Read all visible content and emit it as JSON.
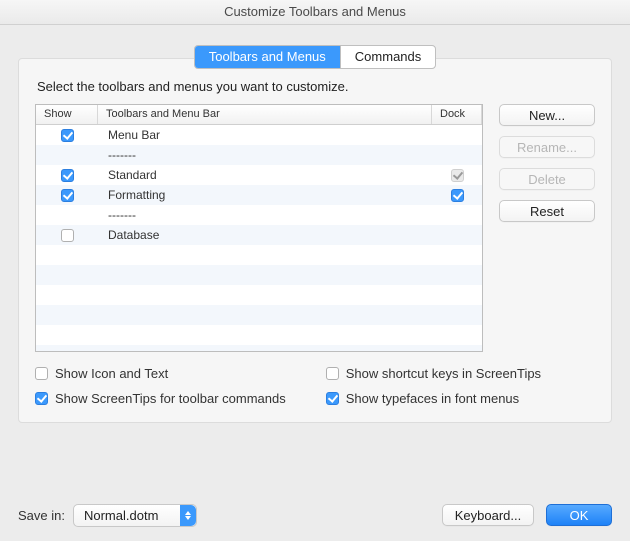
{
  "window": {
    "title": "Customize Toolbars and Menus"
  },
  "tabs": {
    "toolbars": "Toolbars and Menus",
    "commands": "Commands",
    "active": "toolbars"
  },
  "prompt": "Select the toolbars and menus you want to customize.",
  "columns": {
    "show": "Show",
    "name": "Toolbars and Menu Bar",
    "dock": "Dock"
  },
  "rows": [
    {
      "show": "on",
      "name": "Menu Bar",
      "dock": ""
    },
    {
      "show": "",
      "name": "-------",
      "dock": ""
    },
    {
      "show": "on",
      "name": "Standard",
      "dock": "dim"
    },
    {
      "show": "on",
      "name": "Formatting",
      "dock": "on"
    },
    {
      "show": "",
      "name": "-------",
      "dock": ""
    },
    {
      "show": "off",
      "name": "Database",
      "dock": ""
    }
  ],
  "side": {
    "new": "New...",
    "rename": "Rename...",
    "delete": "Delete",
    "reset": "Reset"
  },
  "options": {
    "icon_text": {
      "label": "Show Icon and Text",
      "state": "off"
    },
    "screentips": {
      "label": "Show ScreenTips for toolbar commands",
      "state": "on"
    },
    "shortcut": {
      "label": "Show shortcut keys in ScreenTips",
      "state": "off"
    },
    "typefaces": {
      "label": "Show typefaces in font menus",
      "state": "on"
    }
  },
  "footer": {
    "save_in_label": "Save in:",
    "save_in_value": "Normal.dotm",
    "keyboard": "Keyboard...",
    "ok": "OK"
  }
}
